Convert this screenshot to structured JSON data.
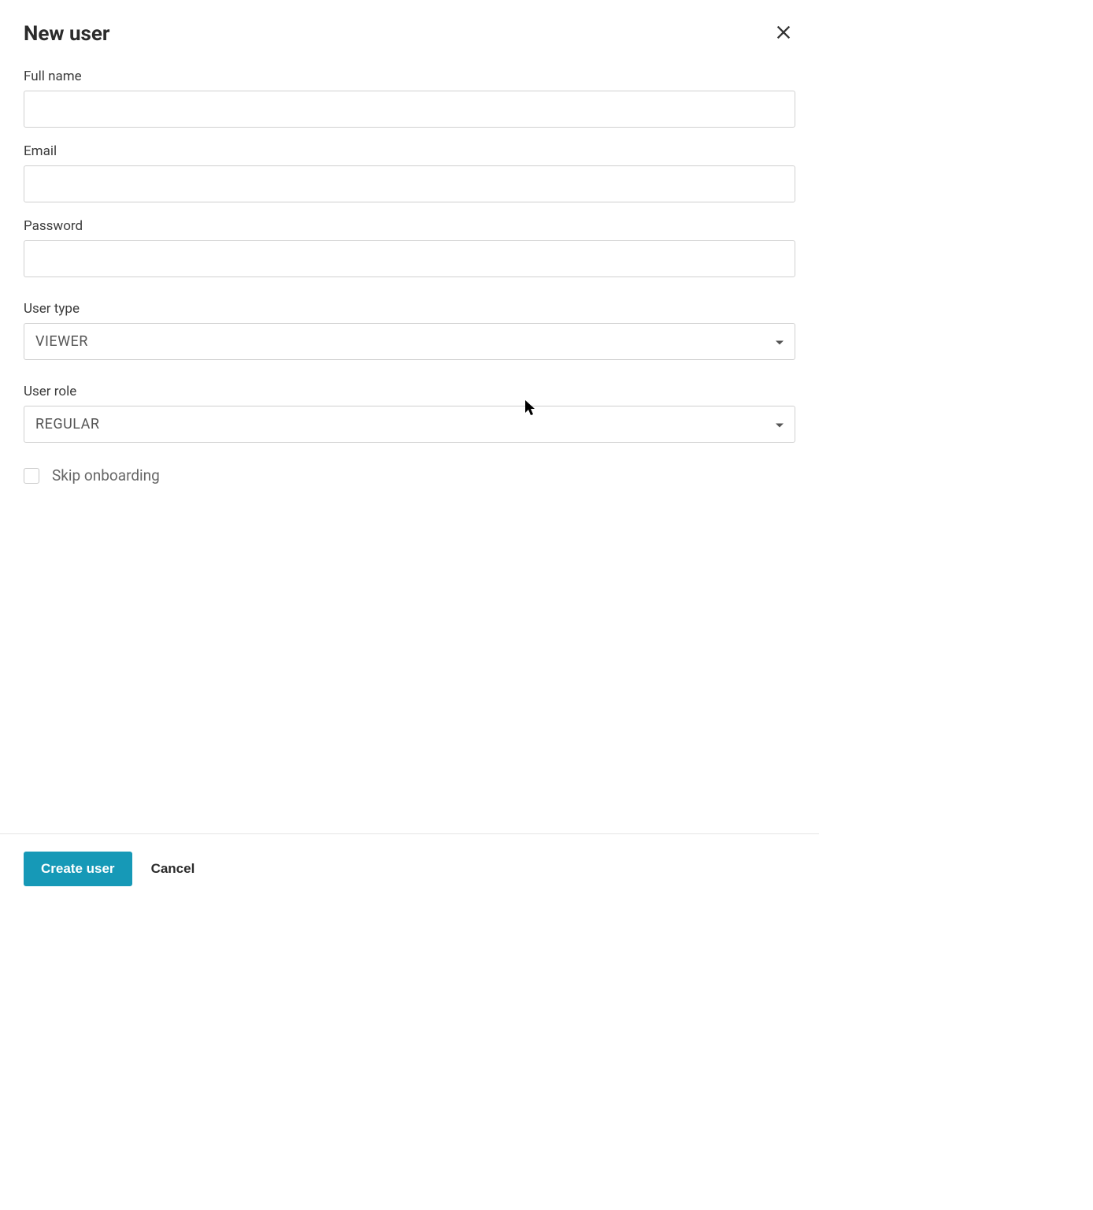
{
  "dialog": {
    "title": "New user"
  },
  "form": {
    "fullName": {
      "label": "Full name",
      "value": ""
    },
    "email": {
      "label": "Email",
      "value": ""
    },
    "password": {
      "label": "Password",
      "value": ""
    },
    "userType": {
      "label": "User type",
      "selected": "VIEWER"
    },
    "userRole": {
      "label": "User role",
      "selected": "REGULAR"
    },
    "skipOnboarding": {
      "label": "Skip onboarding",
      "checked": false
    }
  },
  "footer": {
    "create_label": "Create user",
    "cancel_label": "Cancel"
  }
}
